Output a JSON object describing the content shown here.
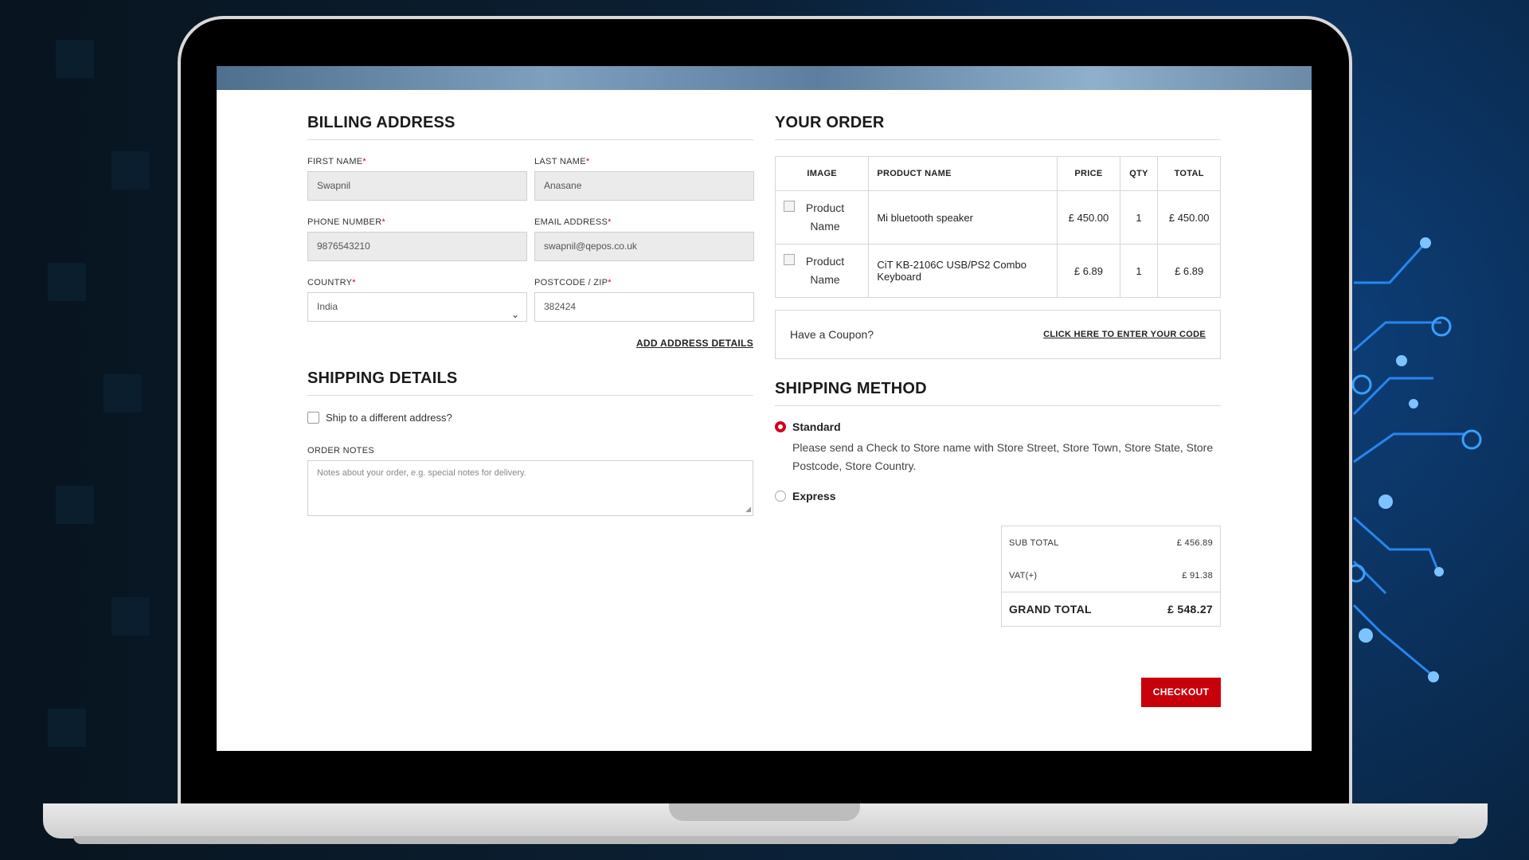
{
  "billing": {
    "title": "BILLING ADDRESS",
    "first_name_label": "FIRST NAME",
    "first_name_value": "Swapnil",
    "last_name_label": "LAST NAME",
    "last_name_value": "Anasane",
    "phone_label": "PHONE NUMBER",
    "phone_value": "9876543210",
    "email_label": "EMAIL ADDRESS",
    "email_value": "swapnil@qepos.co.uk",
    "country_label": "COUNTRY",
    "country_value": "India",
    "postcode_label": "POSTCODE / ZIP",
    "postcode_value": "382424",
    "required_mark": "*",
    "add_address_link": "ADD ADDRESS DETAILS"
  },
  "shipping": {
    "title": "SHIPPING DETAILS",
    "different_address_label": "Ship to a different address?",
    "order_notes_label": "ORDER NOTES",
    "order_notes_placeholder": "Notes about your order, e.g. special notes for delivery."
  },
  "order": {
    "title": "YOUR ORDER",
    "headers": {
      "image": "IMAGE",
      "product_name": "PRODUCT NAME",
      "price": "PRICE",
      "qty": "QTY",
      "total": "TOTAL"
    },
    "items": [
      {
        "image_alt": "Product Name",
        "name": "Mi bluetooth speaker",
        "price": "£ 450.00",
        "qty": "1",
        "total": "£ 450.00"
      },
      {
        "image_alt": "Product Name",
        "name": "CiT KB-2106C USB/PS2 Combo Keyboard",
        "price": "£ 6.89",
        "qty": "1",
        "total": "£ 6.89"
      }
    ],
    "coupon_question": "Have a Coupon?",
    "coupon_link": "CLICK HERE TO ENTER YOUR CODE"
  },
  "shipping_method": {
    "title": "SHIPPING METHOD",
    "options": [
      {
        "label": "Standard",
        "selected": true,
        "description": "Please send a Check to Store name with Store Street, Store Town, Store State, Store Postcode, Store Country."
      },
      {
        "label": "Express",
        "selected": false
      }
    ]
  },
  "totals": {
    "subtotal_label": "SUB TOTAL",
    "subtotal_value": "£ 456.89",
    "vat_label": "VAT(+)",
    "vat_value": "£ 91.38",
    "grand_label": "GRAND TOTAL",
    "grand_value": "£ 548.27"
  },
  "checkout_label": "CHECKOUT",
  "colors": {
    "accent": "#c8000a",
    "required": "#d0021b",
    "circuit": "#2a8fff"
  },
  "icons": {
    "select_chevron": "chevron-down-icon",
    "textarea_resize": "resize-handle-icon"
  }
}
